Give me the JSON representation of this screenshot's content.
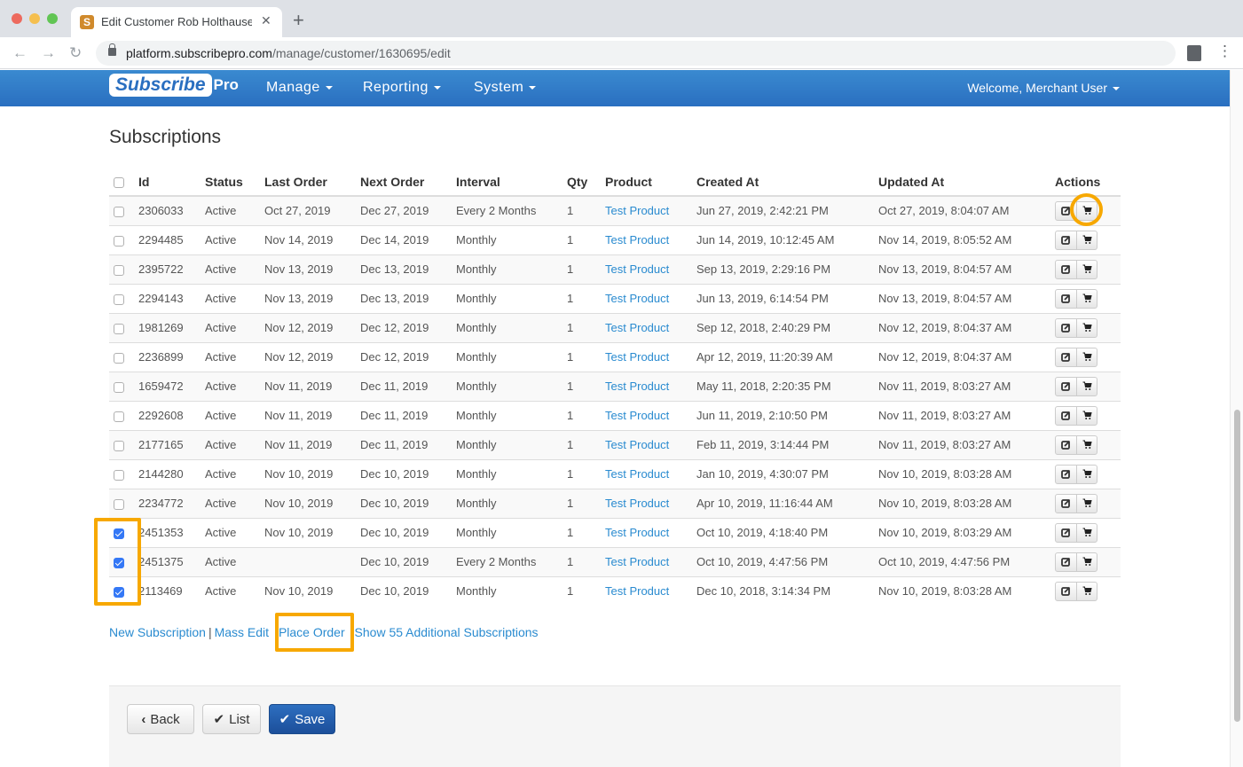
{
  "browser": {
    "tab_title": "Edit Customer Rob Holthause |",
    "url_domain": "platform.subscribepro.com",
    "url_path": "/manage/customer/1630695/edit"
  },
  "navbar": {
    "logo_main": "Subscribe",
    "logo_suffix": "Pro",
    "items": [
      {
        "label": "Manage"
      },
      {
        "label": "Reporting"
      },
      {
        "label": "System"
      }
    ],
    "welcome": "Welcome, Merchant User"
  },
  "subscriptions": {
    "title": "Subscriptions",
    "columns": [
      "Id",
      "Status",
      "Last Order",
      "Next Order",
      "Interval",
      "Qty",
      "Product",
      "Created At",
      "Updated At",
      "Actions"
    ],
    "rows": [
      {
        "checked": false,
        "id": "2306033",
        "status": "Active",
        "last_order": "Oct 27, 2019",
        "next_order": "Dec 27, 2019",
        "interval": "Every 2 Months",
        "qty": "1",
        "product": "Test Product",
        "created_at": "Jun 27, 2019, 2:42:21 PM",
        "updated_at": "Oct 27, 2019, 8:04:07 AM"
      },
      {
        "checked": false,
        "id": "2294485",
        "status": "Active",
        "last_order": "Nov 14, 2019",
        "next_order": "Dec 14, 2019",
        "interval": "Monthly",
        "qty": "1",
        "product": "Test Product",
        "created_at": "Jun 14, 2019, 10:12:45 AM",
        "updated_at": "Nov 14, 2019, 8:05:52 AM"
      },
      {
        "checked": false,
        "id": "2395722",
        "status": "Active",
        "last_order": "Nov 13, 2019",
        "next_order": "Dec 13, 2019",
        "interval": "Monthly",
        "qty": "1",
        "product": "Test Product",
        "created_at": "Sep 13, 2019, 2:29:16 PM",
        "updated_at": "Nov 13, 2019, 8:04:57 AM"
      },
      {
        "checked": false,
        "id": "2294143",
        "status": "Active",
        "last_order": "Nov 13, 2019",
        "next_order": "Dec 13, 2019",
        "interval": "Monthly",
        "qty": "1",
        "product": "Test Product",
        "created_at": "Jun 13, 2019, 6:14:54 PM",
        "updated_at": "Nov 13, 2019, 8:04:57 AM"
      },
      {
        "checked": false,
        "id": "1981269",
        "status": "Active",
        "last_order": "Nov 12, 2019",
        "next_order": "Dec 12, 2019",
        "interval": "Monthly",
        "qty": "1",
        "product": "Test Product",
        "created_at": "Sep 12, 2018, 2:40:29 PM",
        "updated_at": "Nov 12, 2019, 8:04:37 AM"
      },
      {
        "checked": false,
        "id": "2236899",
        "status": "Active",
        "last_order": "Nov 12, 2019",
        "next_order": "Dec 12, 2019",
        "interval": "Monthly",
        "qty": "1",
        "product": "Test Product",
        "created_at": "Apr 12, 2019, 11:20:39 AM",
        "updated_at": "Nov 12, 2019, 8:04:37 AM"
      },
      {
        "checked": false,
        "id": "1659472",
        "status": "Active",
        "last_order": "Nov 11, 2019",
        "next_order": "Dec 11, 2019",
        "interval": "Monthly",
        "qty": "1",
        "product": "Test Product",
        "created_at": "May 11, 2018, 2:20:35 PM",
        "updated_at": "Nov 11, 2019, 8:03:27 AM"
      },
      {
        "checked": false,
        "id": "2292608",
        "status": "Active",
        "last_order": "Nov 11, 2019",
        "next_order": "Dec 11, 2019",
        "interval": "Monthly",
        "qty": "1",
        "product": "Test Product",
        "created_at": "Jun 11, 2019, 2:10:50 PM",
        "updated_at": "Nov 11, 2019, 8:03:27 AM"
      },
      {
        "checked": false,
        "id": "2177165",
        "status": "Active",
        "last_order": "Nov 11, 2019",
        "next_order": "Dec 11, 2019",
        "interval": "Monthly",
        "qty": "1",
        "product": "Test Product",
        "created_at": "Feb 11, 2019, 3:14:44 PM",
        "updated_at": "Nov 11, 2019, 8:03:27 AM"
      },
      {
        "checked": false,
        "id": "2144280",
        "status": "Active",
        "last_order": "Nov 10, 2019",
        "next_order": "Dec 10, 2019",
        "interval": "Monthly",
        "qty": "1",
        "product": "Test Product",
        "created_at": "Jan 10, 2019, 4:30:07 PM",
        "updated_at": "Nov 10, 2019, 8:03:28 AM"
      },
      {
        "checked": false,
        "id": "2234772",
        "status": "Active",
        "last_order": "Nov 10, 2019",
        "next_order": "Dec 10, 2019",
        "interval": "Monthly",
        "qty": "1",
        "product": "Test Product",
        "created_at": "Apr 10, 2019, 11:16:44 AM",
        "updated_at": "Nov 10, 2019, 8:03:28 AM"
      },
      {
        "checked": true,
        "id": "2451353",
        "status": "Active",
        "last_order": "Nov 10, 2019",
        "next_order": "Dec 10, 2019",
        "interval": "Monthly",
        "qty": "1",
        "product": "Test Product",
        "created_at": "Oct 10, 2019, 4:18:40 PM",
        "updated_at": "Nov 10, 2019, 8:03:29 AM"
      },
      {
        "checked": true,
        "id": "2451375",
        "status": "Active",
        "last_order": "",
        "next_order": "Dec 10, 2019",
        "interval": "Every 2 Months",
        "qty": "1",
        "product": "Test Product",
        "created_at": "Oct 10, 2019, 4:47:56 PM",
        "updated_at": "Oct 10, 2019, 4:47:56 PM"
      },
      {
        "checked": true,
        "id": "2113469",
        "status": "Active",
        "last_order": "Nov 10, 2019",
        "next_order": "Dec 10, 2019",
        "interval": "Monthly",
        "qty": "1",
        "product": "Test Product",
        "created_at": "Dec 10, 2018, 3:14:34 PM",
        "updated_at": "Nov 10, 2019, 8:03:28 AM"
      }
    ]
  },
  "footer_links": {
    "new_subscription": "New Subscription",
    "separator": "|",
    "mass_edit": "Mass Edit",
    "place_order": "Place Order",
    "show_more": "Show 55 Additional Subscriptions"
  },
  "form_actions": {
    "back": "Back",
    "list": "List",
    "save": "Save"
  },
  "colors": {
    "navbar": "#2a6fc0",
    "link": "#2a8bd0",
    "highlight": "#f7a800",
    "primary_button": "#1c4f9a",
    "checkbox_checked": "#3478f6"
  }
}
